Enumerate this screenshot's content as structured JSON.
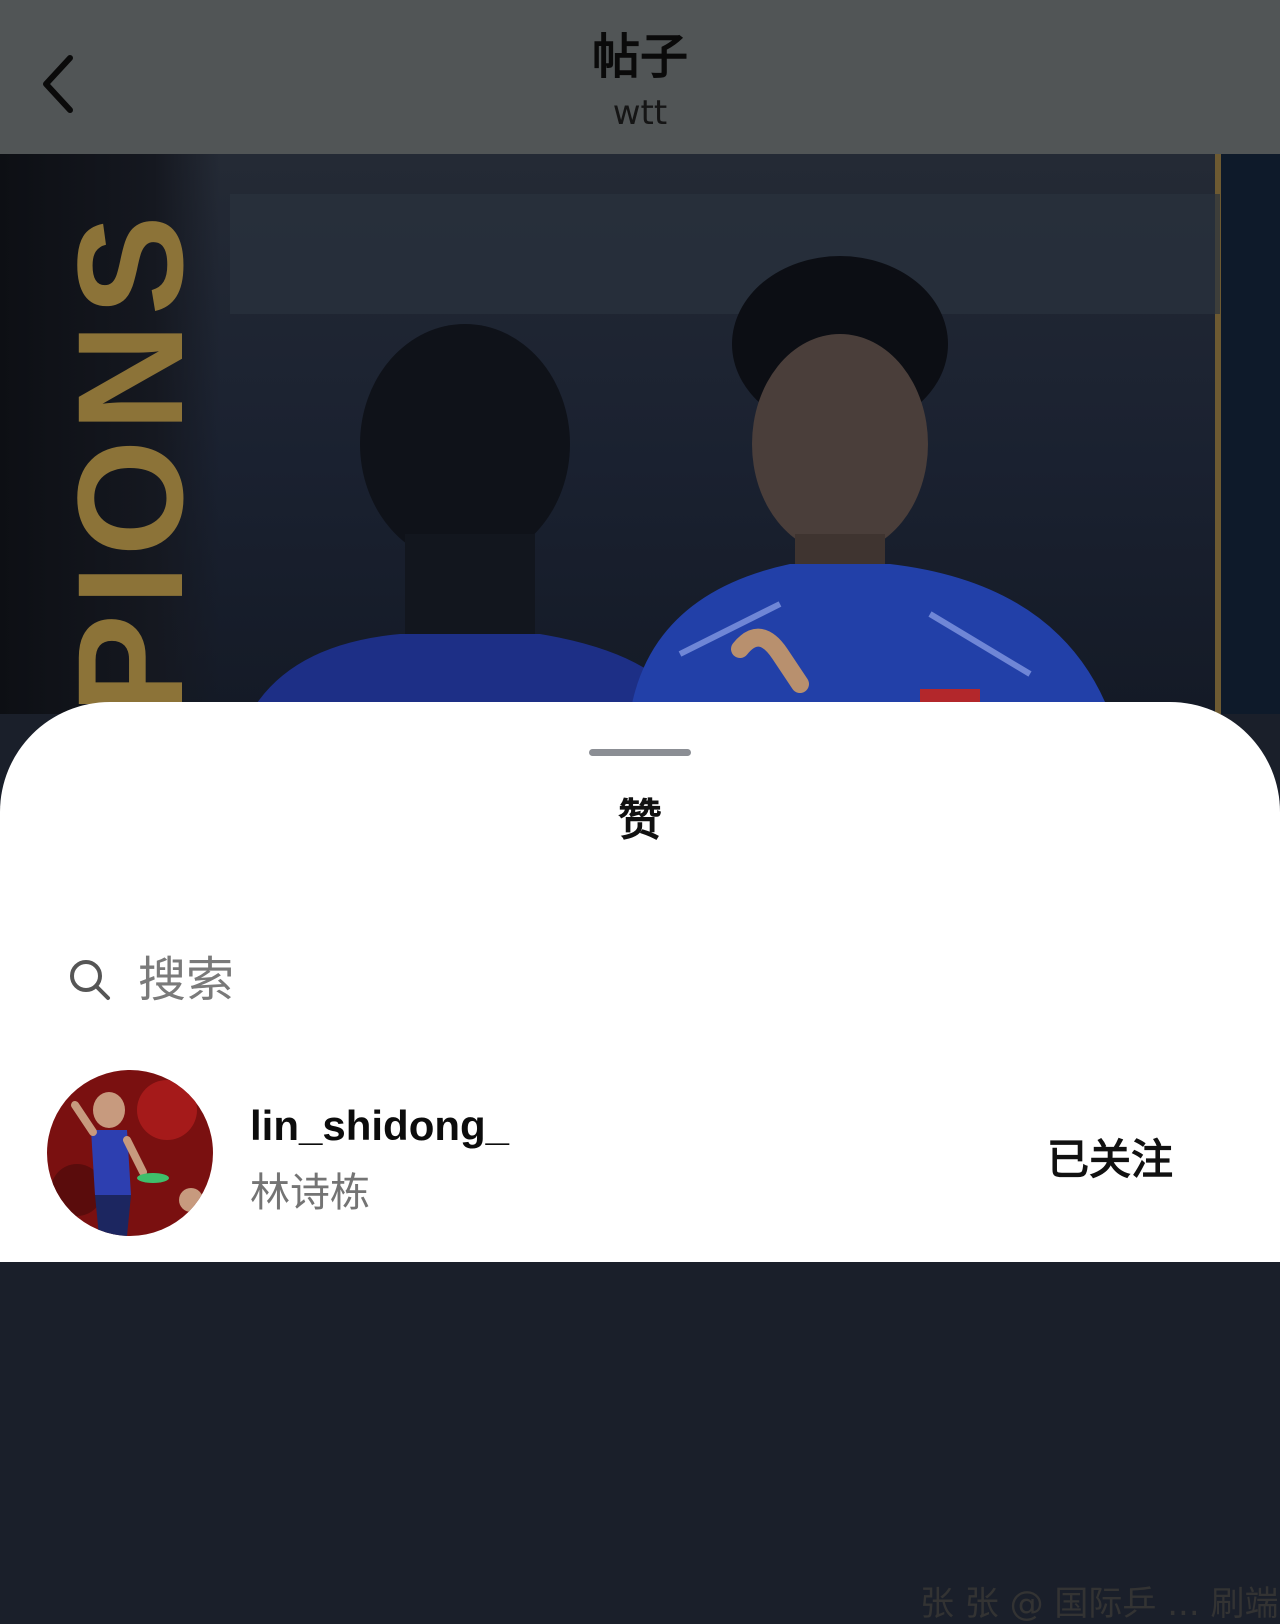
{
  "header": {
    "title": "帖子",
    "subtitle": "wtt",
    "back_icon": "chevron-left-icon"
  },
  "photo": {
    "overlay_text": "PIONS"
  },
  "sheet": {
    "title": "赞",
    "search": {
      "placeholder": "搜索",
      "icon": "search-icon"
    },
    "users": [
      {
        "username": "lin_shidong_",
        "full_name": "林诗栋",
        "follow_label": "已关注",
        "caption": "张 张 @ 国际乒 ... 刷端"
      }
    ]
  },
  "colors": {
    "header_bg": "#515556",
    "sheet_bg": "#ffffff",
    "photo_overlay_gold": "#8c7338",
    "jersey_blue": "#2240a8"
  }
}
